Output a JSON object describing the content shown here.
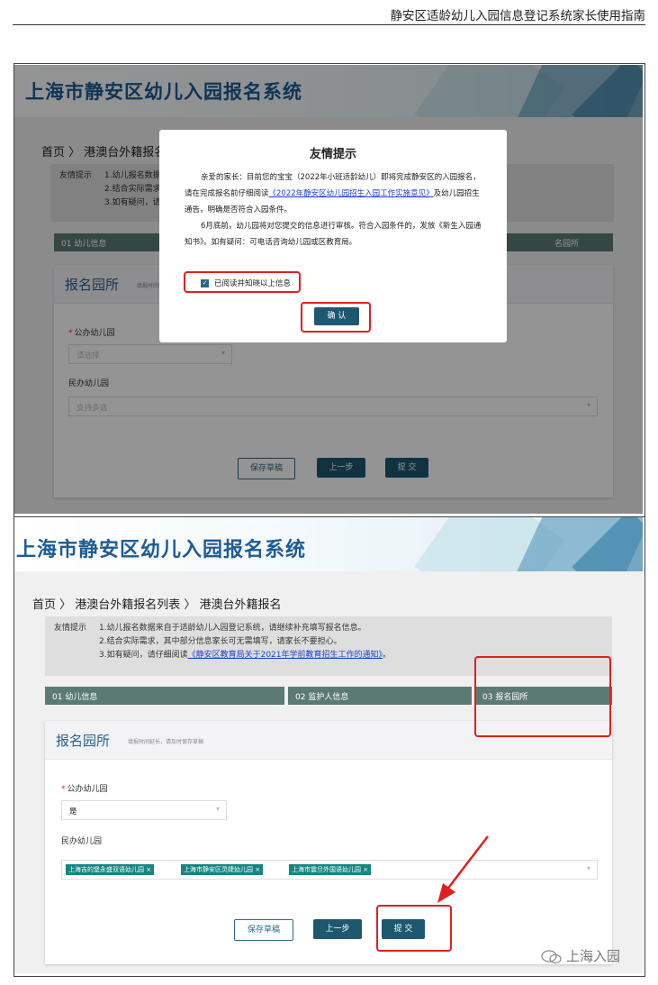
{
  "doc_header": {
    "title": "静安区适龄幼儿入园信息登记系统家长使用指南"
  },
  "system_title": "上海市静安区幼儿入园报名系统",
  "shot1": {
    "breadcrumb": "首页 〉 港澳台外籍报名",
    "notice_label": "友情提示",
    "notice_lines": [
      "1.幼儿报名数据",
      "2.结合实际需求",
      "3.如有疑问，请"
    ],
    "step1": "01 幼儿信息",
    "step3": "名园所",
    "card_title": "报名园所",
    "card_hint": "填报时间延长，",
    "public_label": "公办幼儿园",
    "public_placeholder": "请选择",
    "private_label": "民办幼儿园",
    "private_placeholder": "支持多选",
    "btn_save": "保存草稿",
    "btn_prev": "上一步",
    "btn_submit": "提 交"
  },
  "dialog": {
    "title": "友情提示",
    "para1_a": "亲爱的家长：目前您的宝宝（2022年小班适龄幼儿）即将完成静安区的入园报名，请在完成报名前仔细阅读",
    "para1_link": "《2022年静安区幼儿园招生入园工作实施意见》",
    "para1_b": "及幼儿园招生通告，明确是否符合入园条件。",
    "para2": "6月底前，幼儿园将对您提交的信息进行审核。符合入园条件的，发放《新生入园通知书》。如有疑问：可电话咨询幼儿园或区教育局。",
    "checkbox_label": "已阅读并知晓以上信息",
    "checkbox_mark": "✓",
    "ok_button": "确 认"
  },
  "shot2": {
    "breadcrumb": "首页 〉 港澳台外籍报名列表 〉 港澳台外籍报名",
    "notice_label": "友情提示",
    "notice_line1": "1.幼儿报名数据来自于适龄幼儿入园登记系统，请继续补充填写报名信息。",
    "notice_line2": "2.结合实际需求，其中部分信息家长可无需填写，请家长不要担心。",
    "notice_line3_a": "3.如有疑问，请仔细阅读",
    "notice_line3_link": "《静安区教育局关于2021年学前教育招生工作的通知》",
    "notice_line3_b": "。",
    "step1": "01 幼儿信息",
    "step2": "02 监护人信息",
    "step3": "03 报名园所",
    "card_title": "报名园所",
    "card_hint": "填报时间延长，请及时保存草稿",
    "public_label": "公办幼儿园",
    "public_value": "是",
    "private_label": "民办幼儿园",
    "tags": [
      "上海吉的堡永盛双语幼儿园 ×",
      "上海市静安区灵婕幼儿园 ×",
      "上海市震旦外国语幼儿园 ×"
    ],
    "btn_save": "保存草稿",
    "btn_prev": "上一步",
    "btn_submit": "提 交"
  },
  "watermark": "上海入园",
  "icons": {
    "chevron": "chevron-down-icon",
    "wechat": "wechat-icon"
  },
  "colors": {
    "brand": "#1d5b95",
    "button": "#1d5870",
    "tag": "#17857f",
    "highlight": "#e02020"
  }
}
